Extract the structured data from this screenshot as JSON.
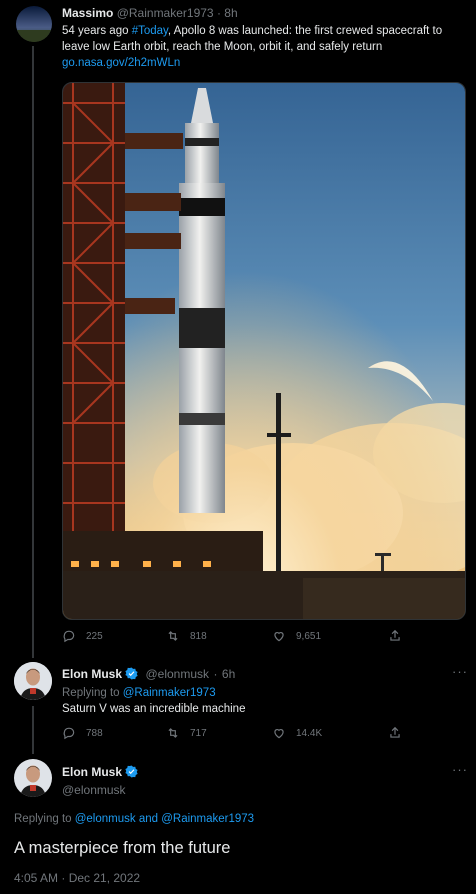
{
  "tweet1": {
    "name": "Massimo",
    "handle": "@Rainmaker1973",
    "time": "8h",
    "text_pre": "54 years ago ",
    "hashtag": "#Today",
    "text_post": ", Apollo 8 was launched: the first crewed spacecraft to leave low Earth orbit, reach the Moon, orbit it, and safely return",
    "link": "go.nasa.gov/2h2mWLn",
    "replies": "225",
    "retweets": "818",
    "likes": "9,651"
  },
  "tweet2": {
    "name": "Elon Musk",
    "handle": "@elonmusk",
    "time": "6h",
    "replying_prefix": "Replying to ",
    "replying_to": "@Rainmaker1973",
    "text": "Saturn V was an incredible machine",
    "replies": "788",
    "retweets": "717",
    "likes": "14.4K"
  },
  "tweet3": {
    "name": "Elon Musk",
    "handle": "@elonmusk",
    "replying_prefix": "Replying to ",
    "replying_to_1": "@elonmusk",
    "replying_and": " and ",
    "replying_to_2": "@Rainmaker1973",
    "text": "A masterpiece from the future",
    "timestamp": "4:05 AM · Dec 21, 2022"
  },
  "colors": {
    "background": "#000000",
    "text": "#e7e9ea",
    "muted": "#71767b",
    "link": "#1d9bf0",
    "verified": "#1d9bf0"
  },
  "icons": [
    "reply-icon",
    "retweet-icon",
    "like-icon",
    "share-icon",
    "more-icon",
    "verified-badge-icon"
  ]
}
